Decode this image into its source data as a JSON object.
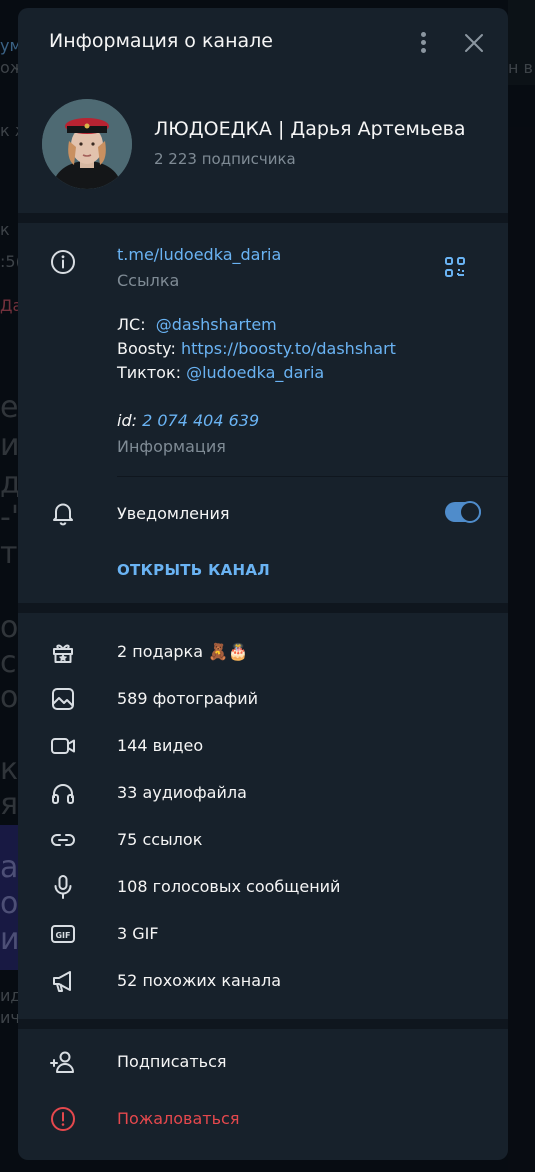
{
  "background": {
    "fragments": [
      "ум",
      "ож",
      "н в",
      "к ж",
      "к",
      ":5(",
      "Да",
      "еб",
      "ин",
      "д",
      "-\"",
      "тя",
      "ос",
      "сн",
      "о",
      "ки",
      "я",
      "ах",
      "о",
      "их",
      "ид",
      "ич"
    ]
  },
  "dialog": {
    "title": "Информация о канале",
    "channel": {
      "name": "ЛЮДОЕДКА | Дарья Артемьева",
      "subscribers": "2 223 подписчика"
    },
    "info": {
      "link": "t.me/ludoedka_daria",
      "link_caption": "Ссылка",
      "ls_label": "ЛС:",
      "ls_value": "@dashshartem",
      "boosty_label": "Boosty:",
      "boosty_value": "https://boosty.to/dashshart",
      "tiktok_label": "Тикток:",
      "tiktok_value": "@ludoedka_daria",
      "id_label": "id:",
      "id_value": "2 074 404 639",
      "info_caption": "Информация"
    },
    "notifications": {
      "label": "Уведомления",
      "enabled": true
    },
    "open_channel": "ОТКРЫТЬ КАНАЛ",
    "media": [
      {
        "icon": "gift-icon",
        "label": "2 подарка 🧸🎂"
      },
      {
        "icon": "photo-icon",
        "label": "589 фотографий"
      },
      {
        "icon": "video-icon",
        "label": "144 видео"
      },
      {
        "icon": "headphones-icon",
        "label": "33 аудиофайла"
      },
      {
        "icon": "link-icon",
        "label": "75 ссылок"
      },
      {
        "icon": "microphone-icon",
        "label": "108 голосовых сообщений"
      },
      {
        "icon": "gif-icon",
        "label": "3 GIF"
      },
      {
        "icon": "megaphone-icon",
        "label": "52 похожих канала"
      }
    ],
    "actions": {
      "subscribe": "Подписаться",
      "report": "Пожаловаться"
    }
  },
  "colors": {
    "accent": "#6ab3f3",
    "danger": "#e5484d",
    "panel": "#17212b",
    "toggle": "#4f8ccb"
  }
}
